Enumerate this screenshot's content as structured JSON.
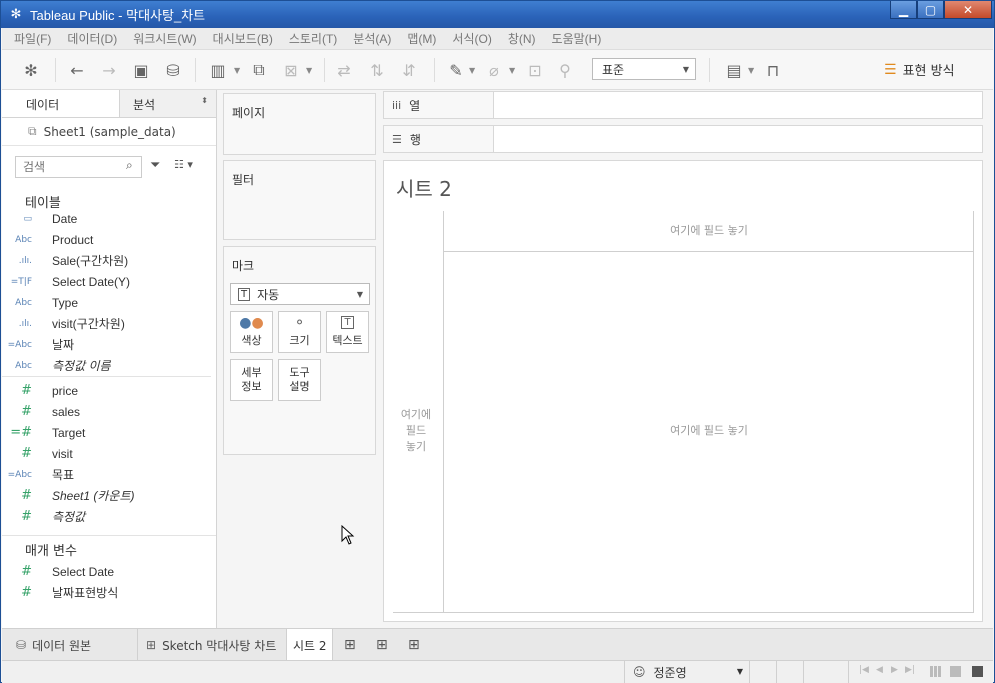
{
  "window": {
    "title": "Tableau Public - 막대사탕_차트"
  },
  "menu": [
    "파일(F)",
    "데이터(D)",
    "워크시트(W)",
    "대시보드(B)",
    "스토리(T)",
    "분석(A)",
    "맵(M)",
    "서식(O)",
    "창(N)",
    "도움말(H)"
  ],
  "toolbar": {
    "format_select": "표준",
    "show_me": "표현 방식"
  },
  "left_pane": {
    "tab_data": "데이터",
    "tab_analytics": "분석",
    "datasource": "Sheet1 (sample_data)",
    "search_placeholder": "검색",
    "tables_header": "테이블",
    "dimensions": [
      {
        "icon": "calendar-icon",
        "glyph": "▭",
        "name": "Date"
      },
      {
        "icon": "abc-icon",
        "glyph": "Abc",
        "name": "Product"
      },
      {
        "icon": "bin-icon",
        "glyph": ".ılı.",
        "name": "Sale(구간차원)"
      },
      {
        "icon": "tf-icon",
        "glyph": "=T|F",
        "name": "Select Date(Y)"
      },
      {
        "icon": "abc-icon",
        "glyph": "Abc",
        "name": "Type"
      },
      {
        "icon": "bin-icon",
        "glyph": ".ılı.",
        "name": "visit(구간차원)"
      },
      {
        "icon": "calc-abc-icon",
        "glyph": "=Abc",
        "name": "날짜"
      },
      {
        "icon": "abc-icon",
        "glyph": "Abc",
        "name": "측정값 이름",
        "italic": true
      }
    ],
    "measures": [
      {
        "icon": "hash-icon",
        "glyph": "#",
        "name": "price"
      },
      {
        "icon": "hash-icon",
        "glyph": "#",
        "name": "sales"
      },
      {
        "icon": "calc-hash-icon",
        "glyph": "=#",
        "name": "Target"
      },
      {
        "icon": "hash-icon",
        "glyph": "#",
        "name": "visit"
      },
      {
        "icon": "calc-abc-icon",
        "glyph": "=Abc",
        "name": "목표"
      },
      {
        "icon": "hash-icon",
        "glyph": "#",
        "name": "Sheet1 (카운트)",
        "italic": true
      },
      {
        "icon": "hash-icon",
        "glyph": "#",
        "name": "측정값",
        "italic": true
      }
    ],
    "params_header": "매개 변수",
    "params": [
      {
        "icon": "hash-icon",
        "glyph": "#",
        "name": "Select Date"
      },
      {
        "icon": "hash-icon",
        "glyph": "#",
        "name": "날짜표현방식"
      }
    ]
  },
  "cards": {
    "pages": "페이지",
    "filters": "필터",
    "marks": "마크",
    "mark_type": "자동",
    "mark_buttons": [
      {
        "icon": "color-icon",
        "label": "색상"
      },
      {
        "icon": "size-icon",
        "label": "크기"
      },
      {
        "icon": "text-icon",
        "label": "텍스트"
      },
      {
        "icon": "detail-icon",
        "label": "세부\n정보"
      },
      {
        "icon": "tooltip-icon",
        "label": "도구\n설명"
      }
    ]
  },
  "shelves": {
    "columns": "열",
    "rows": "행"
  },
  "sheet": {
    "title": "시트 2",
    "drop_top": "여기에 필드 놓기",
    "drop_left": "여기에\n필드\n놓기",
    "drop_center": "여기에 필드 놓기"
  },
  "bottom_tabs": {
    "datasource": "데이터 원본",
    "dashboard": "Sketch 막대사탕 차트",
    "sheet": "시트 2"
  },
  "status": {
    "user": "정준영"
  },
  "colors": {
    "titlebar": "#2a62b8",
    "dimension": "#5a83b5",
    "measure": "#37a36a"
  }
}
